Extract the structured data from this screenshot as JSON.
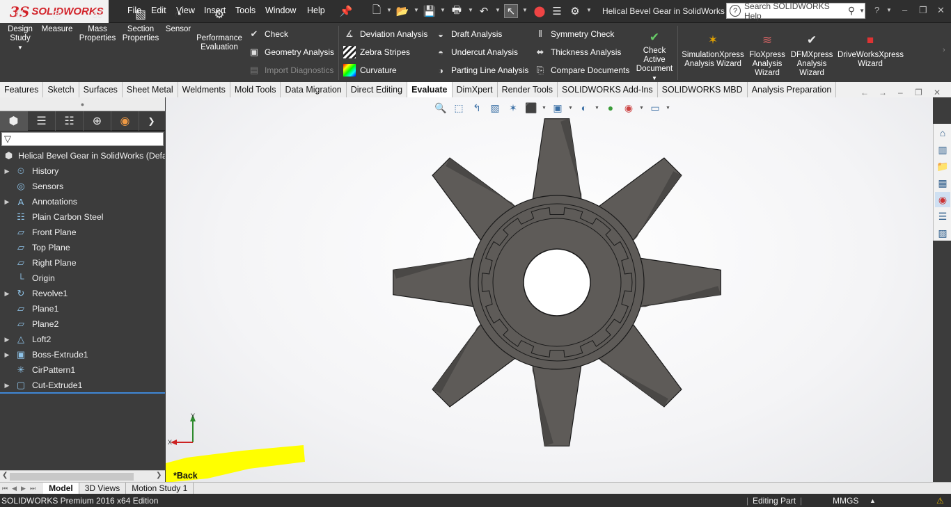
{
  "app": {
    "logo_prefix": "3S",
    "logo_name": "SOLIDWORKS",
    "document_title": "Helical Bevel Gear in SolidWorks",
    "help_search_placeholder": "Search SOLIDWORKS Help"
  },
  "menu": [
    "File",
    "Edit",
    "View",
    "Insert",
    "Tools",
    "Window",
    "Help"
  ],
  "ribbon": {
    "big": [
      {
        "label1": "Design",
        "label2": "Study",
        "icon": "design-study-icon"
      },
      {
        "label1": "Measure",
        "label2": "",
        "icon": "measure-icon"
      },
      {
        "label1": "Mass",
        "label2": "Properties",
        "icon": "mass-properties-icon"
      },
      {
        "label1": "Section",
        "label2": "Properties",
        "icon": "section-properties-icon"
      },
      {
        "label1": "Sensor",
        "label2": "",
        "icon": "sensor-icon"
      },
      {
        "label1": "Performance",
        "label2": "Evaluation",
        "icon": "performance-icon"
      }
    ],
    "col1": [
      "Check",
      "Geometry Analysis",
      "Import Diagnostics"
    ],
    "col2": [
      "Deviation Analysis",
      "Zebra Stripes",
      "Curvature"
    ],
    "col3": [
      "Draft Analysis",
      "Undercut Analysis",
      "Parting Line Analysis"
    ],
    "col4": [
      "Symmetry Check",
      "Thickness Analysis",
      "Compare Documents"
    ],
    "check_active": [
      "Check",
      "Active",
      "Document"
    ],
    "wizards": [
      {
        "label1": "SimulationXpress",
        "label2": "Analysis Wizard",
        "label3": ""
      },
      {
        "label1": "FloXpress",
        "label2": "Analysis",
        "label3": "Wizard"
      },
      {
        "label1": "DFMXpress",
        "label2": "Analysis",
        "label3": "Wizard"
      },
      {
        "label1": "DriveWorksXpress",
        "label2": "Wizard",
        "label3": ""
      }
    ]
  },
  "tabs": [
    "Features",
    "Sketch",
    "Surfaces",
    "Sheet Metal",
    "Weldments",
    "Mold Tools",
    "Data Migration",
    "Direct Editing",
    "Evaluate",
    "DimXpert",
    "Render Tools",
    "SOLIDWORKS Add-Ins",
    "SOLIDWORKS MBD",
    "Analysis Preparation"
  ],
  "active_tab": "Evaluate",
  "tree": {
    "root": "Helical Bevel Gear in SolidWorks  (Defau",
    "items": [
      {
        "label": "History",
        "expandable": true,
        "icon": "history-icon"
      },
      {
        "label": "Sensors",
        "expandable": false,
        "icon": "sensors-icon"
      },
      {
        "label": "Annotations",
        "expandable": true,
        "icon": "annotations-icon"
      },
      {
        "label": "Plain Carbon Steel",
        "expandable": false,
        "icon": "material-icon"
      },
      {
        "label": "Front Plane",
        "expandable": false,
        "icon": "plane-icon"
      },
      {
        "label": "Top Plane",
        "expandable": false,
        "icon": "plane-icon"
      },
      {
        "label": "Right Plane",
        "expandable": false,
        "icon": "plane-icon"
      },
      {
        "label": "Origin",
        "expandable": false,
        "icon": "origin-icon"
      },
      {
        "label": "Revolve1",
        "expandable": true,
        "icon": "revolve-icon"
      },
      {
        "label": "Plane1",
        "expandable": false,
        "icon": "plane-icon"
      },
      {
        "label": "Plane2",
        "expandable": false,
        "icon": "plane-icon"
      },
      {
        "label": "Loft2",
        "expandable": true,
        "icon": "loft-icon"
      },
      {
        "label": "Boss-Extrude1",
        "expandable": true,
        "icon": "extrude-icon"
      },
      {
        "label": "CirPattern1",
        "expandable": false,
        "icon": "pattern-icon"
      },
      {
        "label": "Cut-Extrude1",
        "expandable": true,
        "icon": "cut-extrude-icon"
      }
    ]
  },
  "viewport": {
    "view_label": "*Back",
    "triad_x": "X",
    "triad_y": "Y"
  },
  "bottom_tabs": [
    "Model",
    "3D Views",
    "Motion Study 1"
  ],
  "active_bottom_tab": "Model",
  "status": {
    "edition": "SOLIDWORKS Premium 2016 x64 Edition",
    "mode": "Editing Part",
    "units": "MMGS"
  },
  "colors": {
    "brand": "#d2232a",
    "gear": "#5e5b58",
    "highlight": "#ffff00"
  }
}
